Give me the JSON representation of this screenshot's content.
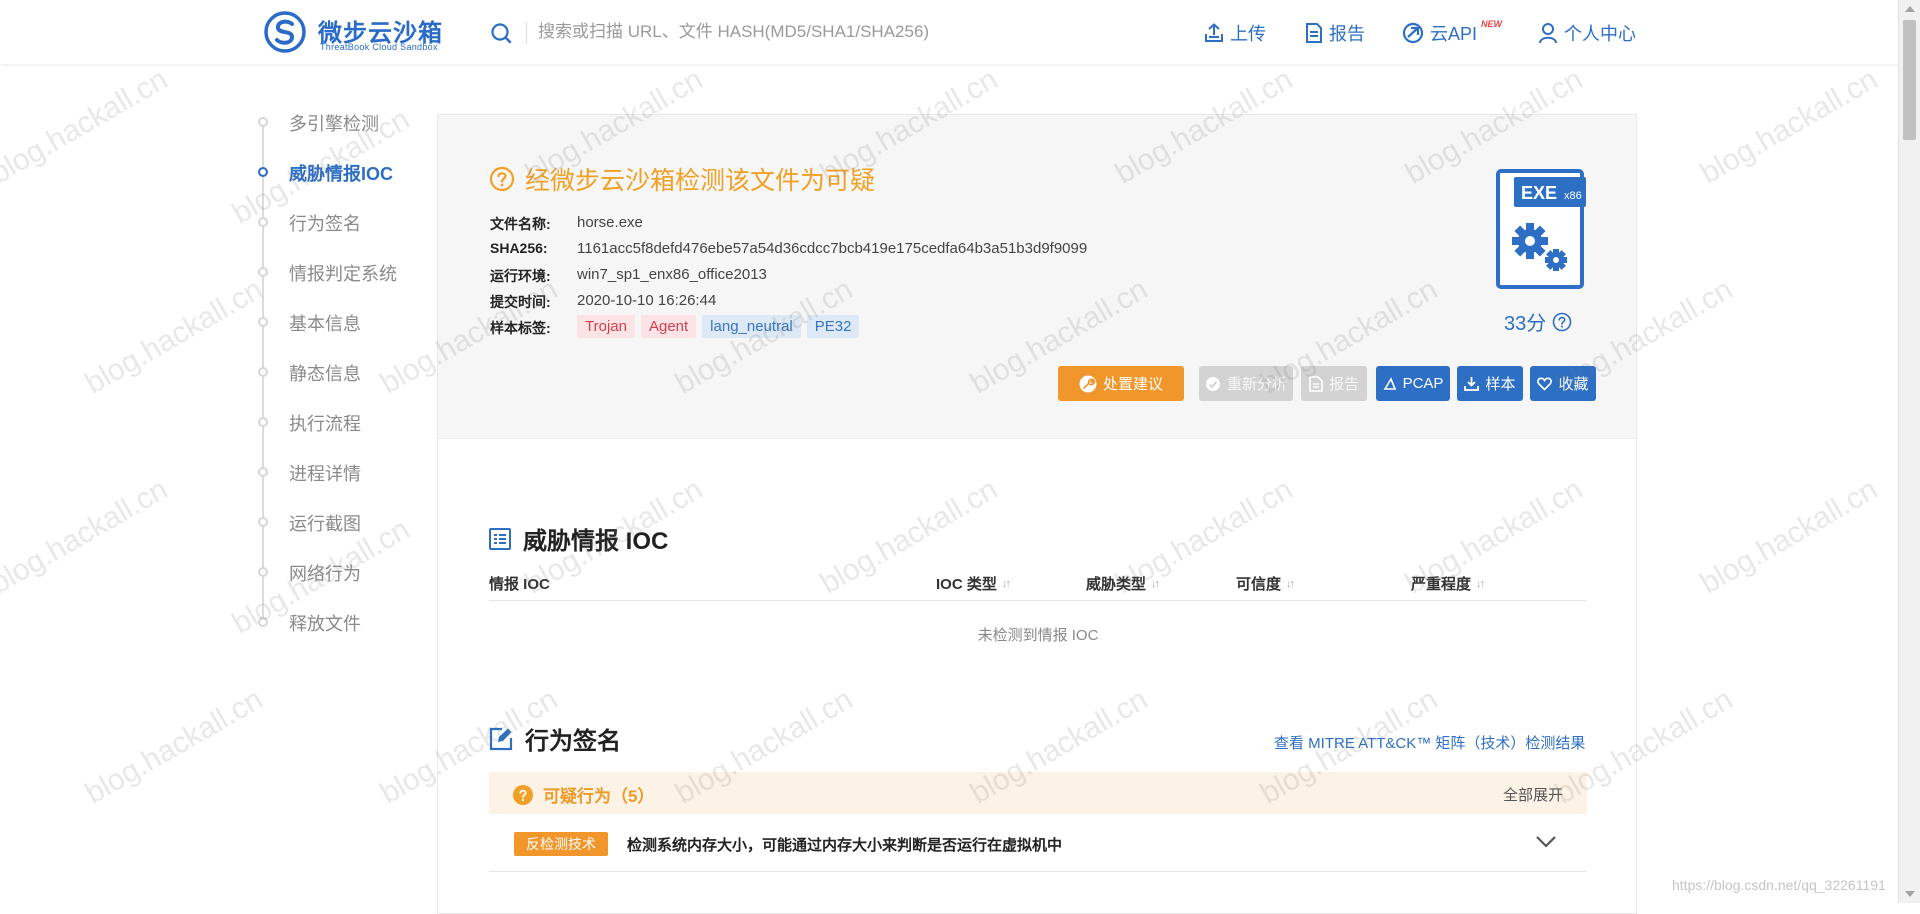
{
  "header": {
    "logo_cn": "微步云沙箱",
    "logo_en": "ThreatBook Cloud Sandbox",
    "search_placeholder": "搜索或扫描 URL、文件 HASH(MD5/SHA1/SHA256)",
    "nav": [
      {
        "label": "上传",
        "icon": "upload-icon"
      },
      {
        "label": "报告",
        "icon": "report-icon"
      },
      {
        "label": "云API",
        "icon": "cloud-api-icon",
        "badge": "NEW"
      },
      {
        "label": "个人中心",
        "icon": "user-icon"
      }
    ]
  },
  "sidebar": {
    "items": [
      {
        "label": "多引擎检测",
        "active": false
      },
      {
        "label": "威胁情报IOC",
        "active": true
      },
      {
        "label": "行为签名",
        "active": false
      },
      {
        "label": "情报判定系统",
        "active": false
      },
      {
        "label": "基本信息",
        "active": false
      },
      {
        "label": "静态信息",
        "active": false
      },
      {
        "label": "执行流程",
        "active": false
      },
      {
        "label": "进程详情",
        "active": false
      },
      {
        "label": "运行截图",
        "active": false
      },
      {
        "label": "网络行为",
        "active": false
      },
      {
        "label": "释放文件",
        "active": false
      }
    ]
  },
  "summary": {
    "verdict": "经微步云沙箱检测该文件为可疑",
    "verdict_color": "#f0a025",
    "rows": [
      {
        "label": "文件名称:",
        "value": "horse.exe"
      },
      {
        "label": "SHA256:",
        "value": "1161acc5f8defd476ebe57a54d36cdcc7bcb419e175cedfa64b3a51b3d9f9099"
      },
      {
        "label": "运行环境:",
        "value": "win7_sp1_enx86_office2013"
      },
      {
        "label": "提交时间:",
        "value": "2020-10-10 16:26:44"
      }
    ],
    "tags_label": "样本标签:",
    "tags": [
      {
        "text": "Trojan",
        "color": "red"
      },
      {
        "text": "Agent",
        "color": "red"
      },
      {
        "text": "lang_neutral",
        "color": "blue"
      },
      {
        "text": "PE32",
        "color": "blue"
      }
    ],
    "file_type": "EXE",
    "file_arch": "x86",
    "score": "33分",
    "buttons": {
      "advice": "处置建议",
      "reanalyze": "重新分析",
      "report": "报告",
      "pcap": "PCAP",
      "sample": "样本",
      "favorite": "收藏"
    }
  },
  "ioc": {
    "title": "威胁情报 IOC",
    "columns": [
      "情报 IOC",
      "IOC 类型",
      "威胁类型",
      "可信度",
      "严重程度"
    ],
    "empty": "未检测到情报 IOC"
  },
  "behavior": {
    "title": "行为签名",
    "mitre_link": "查看 MITRE ATT&CK™ 矩阵（技术）检测结果",
    "group_title": "可疑行为（5）",
    "expand_all": "全部展开",
    "rows": [
      {
        "tag": "反检测技术",
        "text": "检测系统内存大小，可能通过内存大小来判断是否运行在虚拟机中"
      }
    ]
  },
  "watermark": {
    "text": "blog.hackall.cn",
    "csdn": "https://blog.csdn.net/qq_32261191"
  },
  "colors": {
    "brand": "#2d6fc4",
    "warning": "#f0962a",
    "tag_red": "#d2404f",
    "tag_blue": "#3874c4"
  }
}
